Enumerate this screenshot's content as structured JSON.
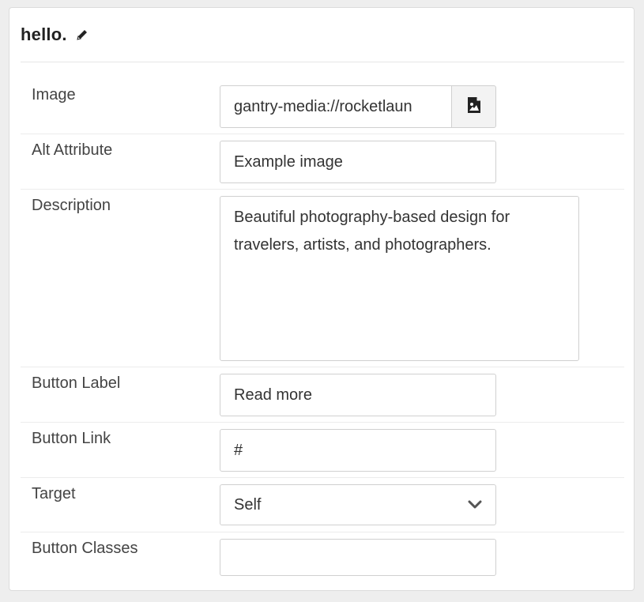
{
  "panel": {
    "title": "hello.",
    "edit_icon": "pencil-icon"
  },
  "fields": {
    "image": {
      "label": "Image",
      "value": "gantry-media://rocketlaun",
      "picker_icon": "image-file-icon"
    },
    "alt": {
      "label": "Alt Attribute",
      "value": "Example image"
    },
    "description": {
      "label": "Description",
      "value": "Beautiful photography-based design for travelers, artists, and photographers."
    },
    "button_label": {
      "label": "Button Label",
      "value": "Read more"
    },
    "button_link": {
      "label": "Button Link",
      "value": "#"
    },
    "target": {
      "label": "Target",
      "value": "Self",
      "icon": "chevron-down-icon"
    },
    "button_classes": {
      "label": "Button Classes",
      "value": ""
    }
  }
}
